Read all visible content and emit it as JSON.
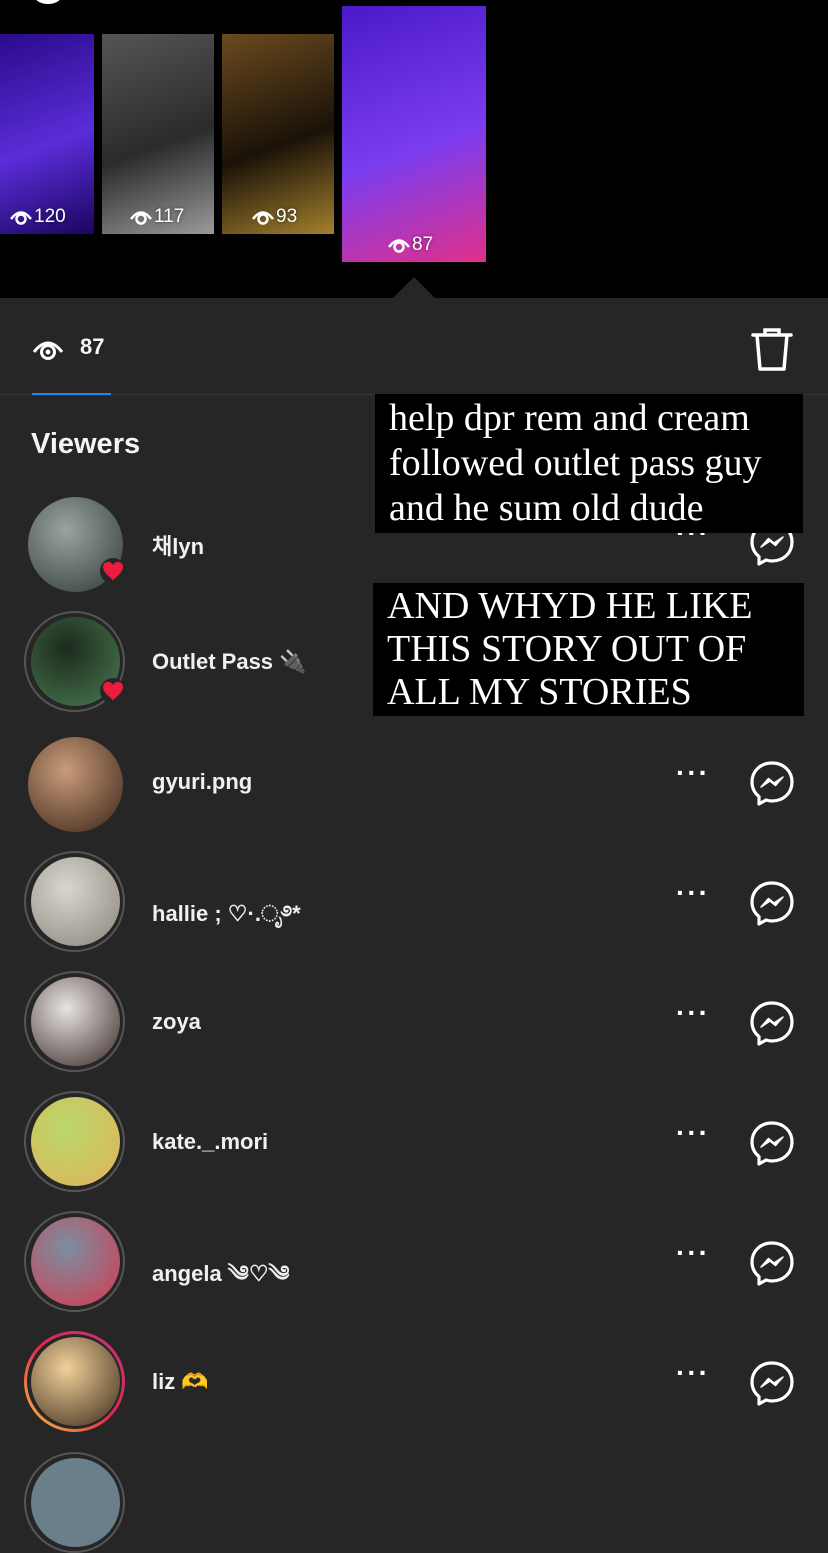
{
  "stories": [
    {
      "views": "120",
      "colors": [
        "#2a0b8a",
        "#5a2dd8",
        "#1b0560"
      ]
    },
    {
      "views": "117",
      "colors": [
        "#555",
        "#2b2b2b",
        "#9a9a9a"
      ]
    },
    {
      "views": "93",
      "colors": [
        "#6b4a1e",
        "#1a1208",
        "#a4802e"
      ]
    },
    {
      "views": "87",
      "colors": [
        "#4b19c8",
        "#7a3df0",
        "#e0308a"
      ]
    }
  ],
  "stats": {
    "view_count": "87"
  },
  "viewers_title": "Viewers",
  "viewers": [
    {
      "name": "채lyn",
      "liked": true,
      "ring": "none",
      "avatar_colors": [
        "#9aa3a0",
        "#2f3a37"
      ]
    },
    {
      "name": "Outlet Pass 🔌",
      "liked": true,
      "ring": "grey",
      "avatar_colors": [
        "#1c2b1c",
        "#4a7a52"
      ]
    },
    {
      "name": "gyuri.png",
      "liked": false,
      "ring": "none",
      "avatar_colors": [
        "#c99c7a",
        "#3a2418"
      ]
    },
    {
      "name": "hallie ; ♡·.ೃ࿔*",
      "liked": false,
      "ring": "grey",
      "avatar_colors": [
        "#d9d6cf",
        "#8a857a"
      ]
    },
    {
      "name": "zoya",
      "liked": false,
      "ring": "grey",
      "avatar_colors": [
        "#e8e4e0",
        "#3a2a2a"
      ]
    },
    {
      "name": "kate._.mori",
      "liked": false,
      "ring": "grey",
      "avatar_colors": [
        "#b9d86a",
        "#e2b25a"
      ]
    },
    {
      "name": "angela ༄♡༄",
      "liked": false,
      "ring": "grey",
      "avatar_colors": [
        "#7a8fa0",
        "#d43a50"
      ]
    },
    {
      "name": "liz 🫶",
      "liked": false,
      "ring": "story",
      "avatar_colors": [
        "#f2d09a",
        "#3a2a1a"
      ]
    }
  ],
  "overlay_texts": [
    "help dpr rem and cream followed outlet pass guy and he sum old dude",
    "AND WHYD HE LIKE THIS STORY OUT OF ALL MY STORIES"
  ],
  "colors": {
    "background": "#262626",
    "accent": "#1e88e5",
    "heart": "#ed1c3c"
  },
  "icons": [
    "eye-icon",
    "trash-icon",
    "more-icon",
    "messenger-icon",
    "heart-icon",
    "close-icon"
  ]
}
